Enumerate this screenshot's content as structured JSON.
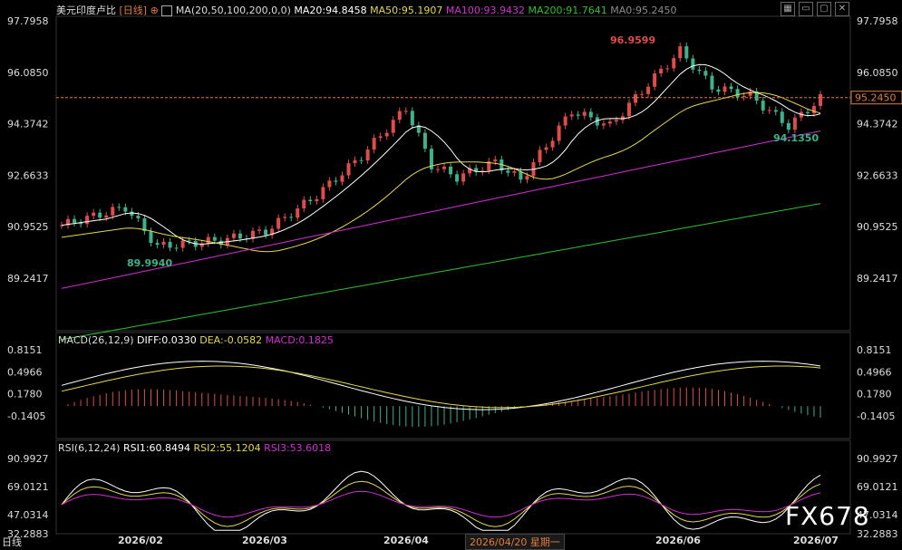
{
  "header": {
    "symbol": "美元印度卢比",
    "period": "[日线]",
    "ma_label": "MA(20,50,100,200,0,0)",
    "ma20": "MA20:94.8458",
    "ma50": "MA50:95.1907",
    "ma100": "MA100:93.9432",
    "ma200": "MA200:91.7641",
    "ma0": "MA0:95.2450"
  },
  "price_axis": [
    "97.7958",
    "96.0850",
    "94.3742",
    "92.6633",
    "90.9525",
    "89.2417"
  ],
  "price_axis_values": [
    97.7958,
    96.085,
    94.3742,
    92.6633,
    90.9525,
    89.2417
  ],
  "current_price": "95.2450",
  "current_price_value": 95.245,
  "annotations": {
    "high": "96.9599",
    "low1": "89.9940",
    "low2": "94.1350"
  },
  "macd": {
    "label": "MACD(26,12,9)",
    "diff": "DIFF:0.0330",
    "dea": "DEA:-0.0582",
    "macd": "MACD:0.1825",
    "axis": [
      "0.8151",
      "0.4966",
      "0.1780",
      "-0.1405"
    ],
    "axis_values": [
      0.8151,
      0.4966,
      0.178,
      -0.1405
    ]
  },
  "rsi": {
    "label": "RSI(6,12,24)",
    "rsi1": "RSI1:60.8494",
    "rsi2": "RSI2:55.1204",
    "rsi3": "RSI3:53.6018",
    "axis": [
      "90.9927",
      "69.0121",
      "47.0314",
      "32.2883"
    ],
    "axis_values": [
      90.9927,
      69.0121,
      47.0314,
      32.2883
    ]
  },
  "x_axis": [
    "2026/02",
    "2026/03",
    "2026/04",
    "2026/06",
    "2026/07"
  ],
  "date_hint": "2026/04/20 星期一",
  "tab_label": "日线",
  "logo": "FX678",
  "colors": {
    "up": "#e04b4b",
    "down": "#3cb38a",
    "ma20": "#ffffff",
    "ma50": "#e6d84a",
    "ma100": "#d22ed2",
    "ma200": "#2fc02f",
    "ma0": "#8c8c8c",
    "price_tag": "#e07c3c"
  }
}
